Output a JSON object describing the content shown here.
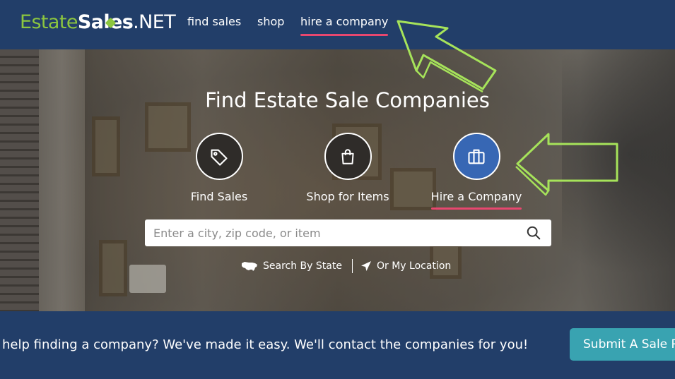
{
  "header": {
    "logo": {
      "part1": "Estate",
      "part2": "Sales",
      "part3": ".NET"
    },
    "nav": [
      {
        "label": "find sales",
        "active": false
      },
      {
        "label": "shop",
        "active": false
      },
      {
        "label": "hire a company",
        "active": true
      }
    ]
  },
  "hero": {
    "title": "Find Estate Sale Companies",
    "categories": [
      {
        "label": "Find Sales",
        "icon": "tag-icon",
        "active": false
      },
      {
        "label": "Shop for Items",
        "icon": "shopping-bag-icon",
        "active": false
      },
      {
        "label": "Hire a Company",
        "icon": "briefcase-icon",
        "active": true
      }
    ],
    "search": {
      "placeholder": "Enter a city, zip code, or item",
      "value": ""
    },
    "links": {
      "by_state": "Search By State",
      "my_location": "Or My Location"
    }
  },
  "bottom": {
    "message": "help finding a company? We've made it easy. We'll contact the companies for you!",
    "button": "Submit A Sale Request"
  },
  "colors": {
    "navy": "#223e69",
    "brand_green": "#8cc63f",
    "active_underline": "#e8476f",
    "active_circle": "#3767b4",
    "button_teal": "#39a3b1",
    "annotation_arrow": "#a6e35a"
  }
}
